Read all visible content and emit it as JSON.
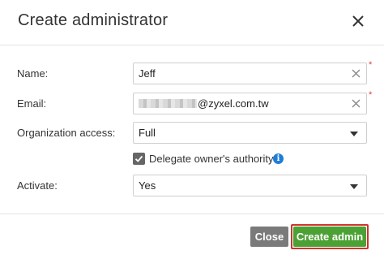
{
  "dialog": {
    "title": "Create administrator",
    "close_icon": "close-icon"
  },
  "form": {
    "name": {
      "label": "Name:",
      "value": "Jeff",
      "required_mark": "*"
    },
    "email": {
      "label": "Email:",
      "value_visible": "@zyxel.com.tw",
      "required_mark": "*"
    },
    "org_access": {
      "label": "Organization access:",
      "selected": "Full"
    },
    "delegate": {
      "label": "Delegate owner's authority",
      "checked": true,
      "info_glyph": "i"
    },
    "activate": {
      "label": "Activate:",
      "selected": "Yes"
    }
  },
  "footer": {
    "close_label": "Close",
    "create_label": "Create admin"
  },
  "colors": {
    "primary_button": "#4ca135",
    "secondary_button": "#7a7a7a",
    "highlight_border": "#d0342c",
    "required": "#e0402b",
    "info": "#1e7ed6"
  }
}
